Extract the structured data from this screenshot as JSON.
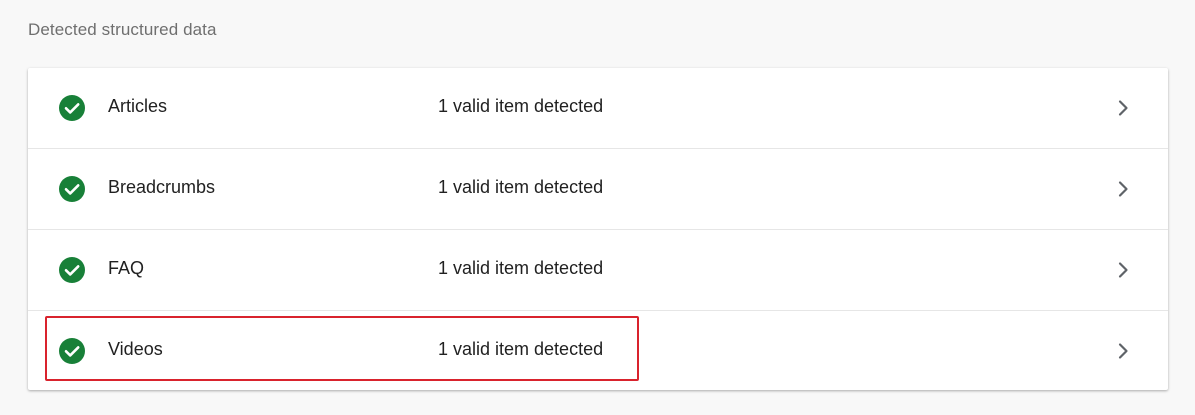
{
  "section": {
    "title": "Detected structured data"
  },
  "items": [
    {
      "name": "Articles",
      "status": "1 valid item detected",
      "icon": "check-circle-icon"
    },
    {
      "name": "Breadcrumbs",
      "status": "1 valid item detected",
      "icon": "check-circle-icon"
    },
    {
      "name": "FAQ",
      "status": "1 valid item detected",
      "icon": "check-circle-icon"
    },
    {
      "name": "Videos",
      "status": "1 valid item detected",
      "icon": "check-circle-icon"
    }
  ],
  "colors": {
    "valid_green": "#188038",
    "highlight_red": "#d9232d",
    "chevron_gray": "#5f6368"
  }
}
